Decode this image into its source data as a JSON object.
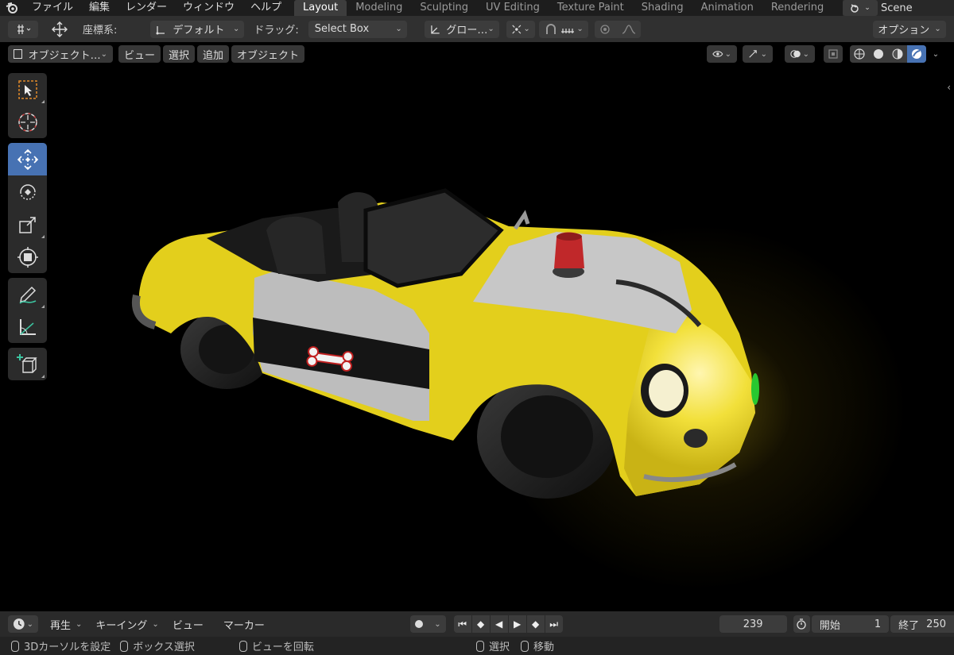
{
  "menu": {
    "items": [
      "ファイル",
      "編集",
      "レンダー",
      "ウィンドウ",
      "ヘルプ"
    ]
  },
  "workspaces": {
    "tabs": [
      {
        "label": "Layout",
        "active": true
      },
      {
        "label": "Modeling",
        "active": false
      },
      {
        "label": "Sculpting",
        "active": false
      },
      {
        "label": "UV Editing",
        "active": false
      },
      {
        "label": "Texture Paint",
        "active": false
      },
      {
        "label": "Shading",
        "active": false
      },
      {
        "label": "Animation",
        "active": false
      },
      {
        "label": "Rendering",
        "active": false
      }
    ]
  },
  "scene": {
    "name": "Scene"
  },
  "tool_header": {
    "orientation_label": "座標系:",
    "orientation_value": "デフォルト",
    "drag_label": "ドラッグ:",
    "drag_value": "Select Box",
    "pivot_value": "グロー…",
    "options_label": "オプション"
  },
  "view_header": {
    "mode": "オブジェクト…",
    "view": "ビュー",
    "select": "選択",
    "add": "追加",
    "object": "オブジェクト"
  },
  "toolbar": {
    "tools": [
      "select-box",
      "cursor",
      "move",
      "rotate",
      "scale",
      "transform",
      "annotate",
      "measure",
      "add-cube"
    ],
    "active_tool": "move"
  },
  "timeline": {
    "playback": "再生",
    "keying": "キーイング",
    "view": "ビュー",
    "marker": "マーカー",
    "current_frame": "239",
    "start_label": "開始",
    "start_value": "1",
    "end_label": "終了",
    "end_value": "250"
  },
  "status": {
    "cursor": "3Dカーソルを設定",
    "box_select": "ボックス選択",
    "rotate_view": "ビューを回転",
    "select": "選択",
    "move": "移動"
  },
  "colors": {
    "accent": "#4772b3",
    "car_body": "#e6d21c",
    "beacon": "#c0282a"
  }
}
